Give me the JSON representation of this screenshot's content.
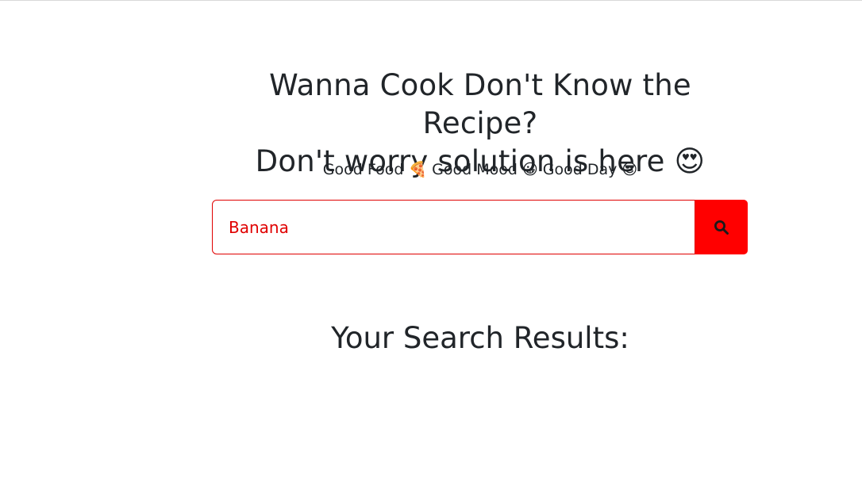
{
  "hero": {
    "title_line1": "Wanna Cook Don't Know the Recipe?",
    "title_line2": "Don't worry solution is here 😍",
    "tagline": "Good Food 🍕 Good Mood 😀 Good Day 😎"
  },
  "search": {
    "value": "Banana",
    "placeholder": "",
    "button_icon": "search-icon",
    "accent_color": "#ff0000"
  },
  "results": {
    "heading": "Your Search Results:"
  }
}
